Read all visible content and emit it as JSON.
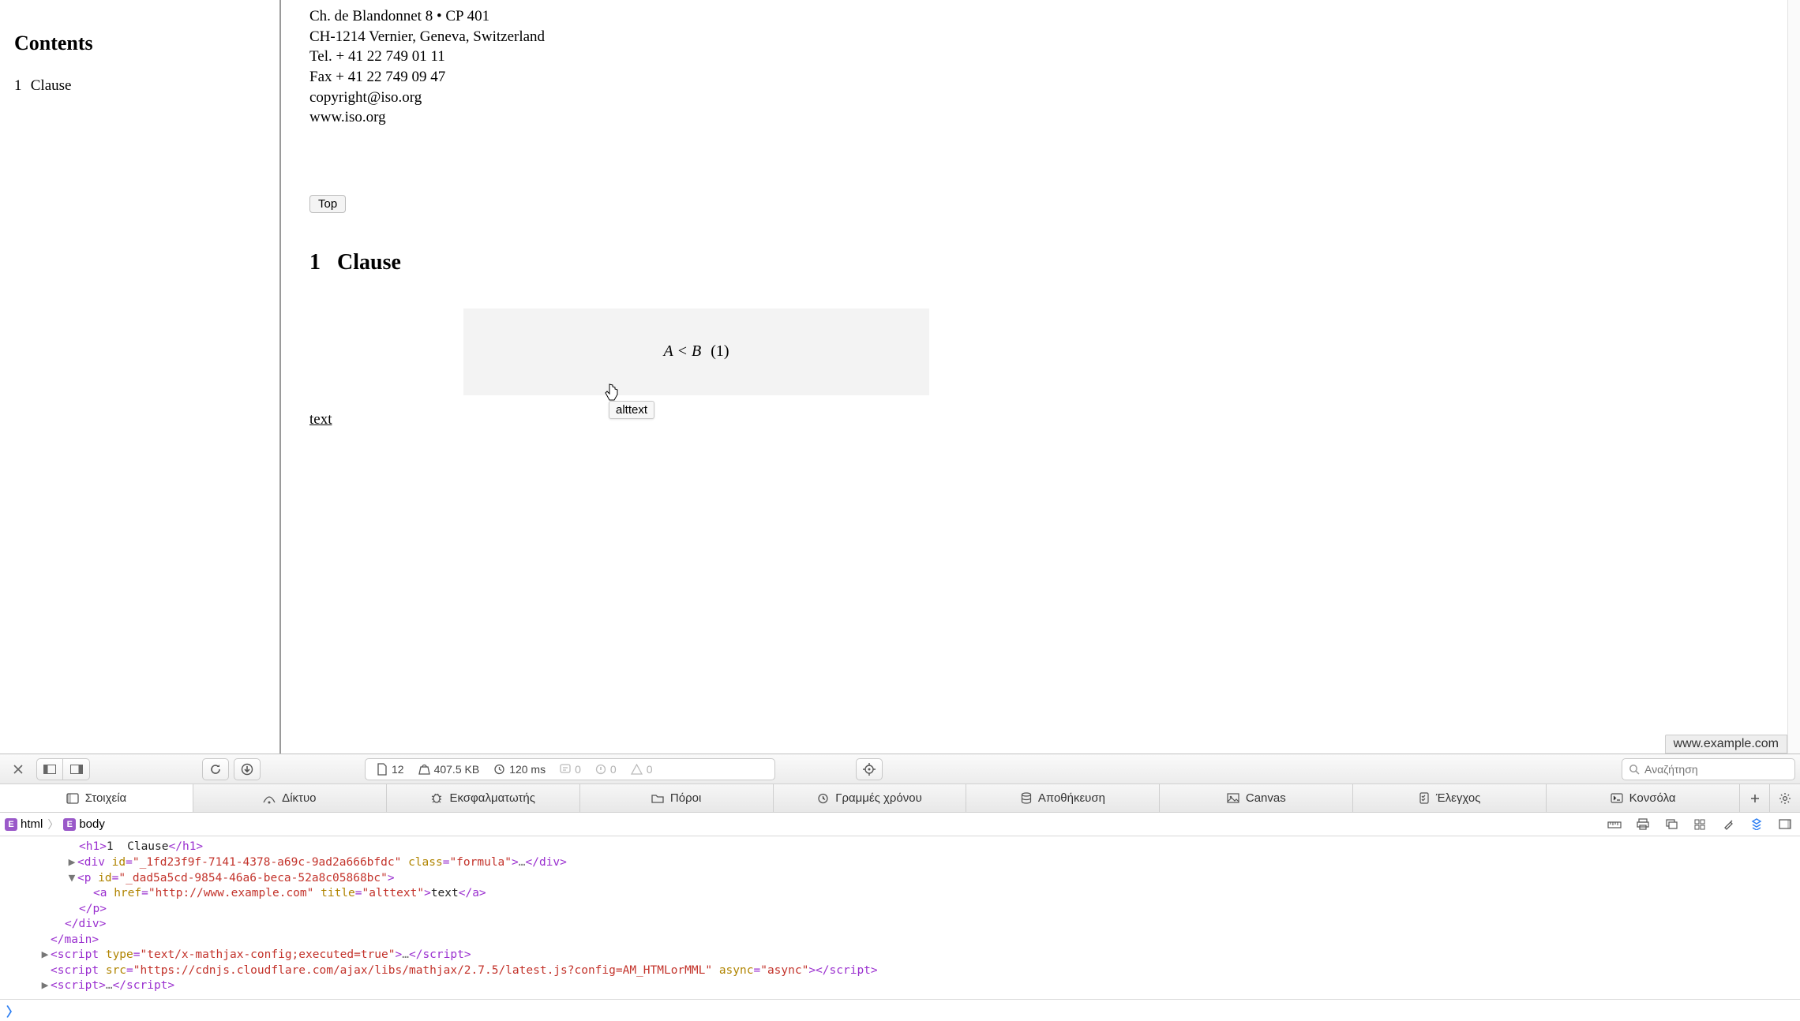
{
  "sidebar": {
    "title": "Contents",
    "items": [
      {
        "num": "1",
        "label": "Clause"
      }
    ]
  },
  "document": {
    "address": [
      "Ch. de Blandonnet 8 • CP 401",
      "CH-1214 Vernier, Geneva, Switzerland",
      "Tel.  + 41 22 749 01 11",
      "Fax  + 41 22 749 09 47",
      "copyright@iso.org",
      "www.iso.org"
    ],
    "top_button": "Top",
    "clause": {
      "num": "1",
      "title": "Clause"
    },
    "formula": {
      "lhs": "A",
      "op": "<",
      "rhs": "B",
      "eqnum": "(1)"
    },
    "link": {
      "text": "text",
      "tooltip": "alttext",
      "status_url": "www.example.com"
    }
  },
  "devtools": {
    "stats": {
      "requests": "12",
      "size": "407.5 KB",
      "time": "120 ms",
      "logs": "0",
      "errors": "0",
      "warnings": "0"
    },
    "search_placeholder": "Αναζήτηση",
    "tabs": [
      "Στοιχεία",
      "Δίκτυο",
      "Εκσφαλματωτής",
      "Πόροι",
      "Γραμμές χρόνου",
      "Αποθήκευση",
      "Canvas",
      "Έλεγχος",
      "Κονσόλα"
    ],
    "breadcrumbs": [
      "html",
      "body"
    ],
    "source": {
      "l1_pre": "<h1>",
      "l1_txt": "1  Clause",
      "l1_post": "</h1>",
      "l2_open": "<div ",
      "l2_id_name": "id",
      "l2_id_val": "\"_1fd23f9f-7141-4378-a69c-9ad2a666bfdc\"",
      "l2_cls_name": "class",
      "l2_cls_val": "\"formula\"",
      "l2_mid": ">",
      "l2_ell": "…",
      "l2_close": "</div>",
      "l3_open": "<p ",
      "l3_id_name": "id",
      "l3_id_val": "\"_dad5a5cd-9854-46a6-beca-52a8c05868bc\"",
      "l3_close": ">",
      "l4_open": "<a ",
      "l4_href_name": "href",
      "l4_href_val": "\"http://www.example.com\"",
      "l4_title_name": "title",
      "l4_title_val": "\"alttext\"",
      "l4_mid": ">",
      "l4_txt": "text",
      "l4_close": "</a>",
      "l5": "</p>",
      "l6": "</div>",
      "l7": "</main>",
      "l8_open": "<script ",
      "l8_type_name": "type",
      "l8_type_val": "\"text/x-mathjax-config;executed=true\"",
      "l8_mid": ">",
      "l8_ell": "…",
      "l8_close": "</script>",
      "l9_open": "<script ",
      "l9_src_name": "src",
      "l9_src_val": "\"https://cdnjs.cloudflare.com/ajax/libs/mathjax/2.7.5/latest.js?config=AM_HTMLorMML\"",
      "l9_async_name": "async",
      "l9_async_val": "\"async\"",
      "l9_mid": ">",
      "l9_close": "</script>",
      "l10_open": "<script",
      "l10_mid": ">",
      "l10_ell": "…",
      "l10_close": "</script>"
    }
  }
}
